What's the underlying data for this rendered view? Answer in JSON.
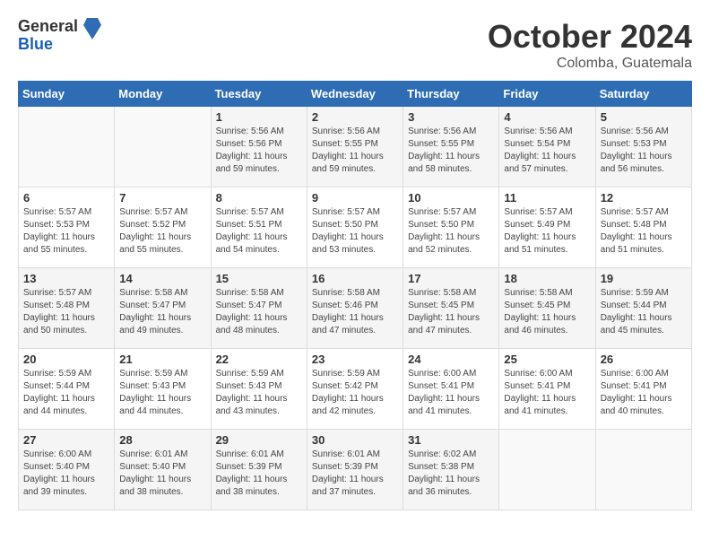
{
  "logo": {
    "general": "General",
    "blue": "Blue"
  },
  "title": "October 2024",
  "location": "Colomba, Guatemala",
  "days_of_week": [
    "Sunday",
    "Monday",
    "Tuesday",
    "Wednesday",
    "Thursday",
    "Friday",
    "Saturday"
  ],
  "weeks": [
    [
      {
        "day": "",
        "sunrise": "",
        "sunset": "",
        "daylight": ""
      },
      {
        "day": "",
        "sunrise": "",
        "sunset": "",
        "daylight": ""
      },
      {
        "day": "1",
        "sunrise": "Sunrise: 5:56 AM",
        "sunset": "Sunset: 5:56 PM",
        "daylight": "Daylight: 11 hours and 59 minutes."
      },
      {
        "day": "2",
        "sunrise": "Sunrise: 5:56 AM",
        "sunset": "Sunset: 5:55 PM",
        "daylight": "Daylight: 11 hours and 59 minutes."
      },
      {
        "day": "3",
        "sunrise": "Sunrise: 5:56 AM",
        "sunset": "Sunset: 5:55 PM",
        "daylight": "Daylight: 11 hours and 58 minutes."
      },
      {
        "day": "4",
        "sunrise": "Sunrise: 5:56 AM",
        "sunset": "Sunset: 5:54 PM",
        "daylight": "Daylight: 11 hours and 57 minutes."
      },
      {
        "day": "5",
        "sunrise": "Sunrise: 5:56 AM",
        "sunset": "Sunset: 5:53 PM",
        "daylight": "Daylight: 11 hours and 56 minutes."
      }
    ],
    [
      {
        "day": "6",
        "sunrise": "Sunrise: 5:57 AM",
        "sunset": "Sunset: 5:53 PM",
        "daylight": "Daylight: 11 hours and 55 minutes."
      },
      {
        "day": "7",
        "sunrise": "Sunrise: 5:57 AM",
        "sunset": "Sunset: 5:52 PM",
        "daylight": "Daylight: 11 hours and 55 minutes."
      },
      {
        "day": "8",
        "sunrise": "Sunrise: 5:57 AM",
        "sunset": "Sunset: 5:51 PM",
        "daylight": "Daylight: 11 hours and 54 minutes."
      },
      {
        "day": "9",
        "sunrise": "Sunrise: 5:57 AM",
        "sunset": "Sunset: 5:50 PM",
        "daylight": "Daylight: 11 hours and 53 minutes."
      },
      {
        "day": "10",
        "sunrise": "Sunrise: 5:57 AM",
        "sunset": "Sunset: 5:50 PM",
        "daylight": "Daylight: 11 hours and 52 minutes."
      },
      {
        "day": "11",
        "sunrise": "Sunrise: 5:57 AM",
        "sunset": "Sunset: 5:49 PM",
        "daylight": "Daylight: 11 hours and 51 minutes."
      },
      {
        "day": "12",
        "sunrise": "Sunrise: 5:57 AM",
        "sunset": "Sunset: 5:48 PM",
        "daylight": "Daylight: 11 hours and 51 minutes."
      }
    ],
    [
      {
        "day": "13",
        "sunrise": "Sunrise: 5:57 AM",
        "sunset": "Sunset: 5:48 PM",
        "daylight": "Daylight: 11 hours and 50 minutes."
      },
      {
        "day": "14",
        "sunrise": "Sunrise: 5:58 AM",
        "sunset": "Sunset: 5:47 PM",
        "daylight": "Daylight: 11 hours and 49 minutes."
      },
      {
        "day": "15",
        "sunrise": "Sunrise: 5:58 AM",
        "sunset": "Sunset: 5:47 PM",
        "daylight": "Daylight: 11 hours and 48 minutes."
      },
      {
        "day": "16",
        "sunrise": "Sunrise: 5:58 AM",
        "sunset": "Sunset: 5:46 PM",
        "daylight": "Daylight: 11 hours and 47 minutes."
      },
      {
        "day": "17",
        "sunrise": "Sunrise: 5:58 AM",
        "sunset": "Sunset: 5:45 PM",
        "daylight": "Daylight: 11 hours and 47 minutes."
      },
      {
        "day": "18",
        "sunrise": "Sunrise: 5:58 AM",
        "sunset": "Sunset: 5:45 PM",
        "daylight": "Daylight: 11 hours and 46 minutes."
      },
      {
        "day": "19",
        "sunrise": "Sunrise: 5:59 AM",
        "sunset": "Sunset: 5:44 PM",
        "daylight": "Daylight: 11 hours and 45 minutes."
      }
    ],
    [
      {
        "day": "20",
        "sunrise": "Sunrise: 5:59 AM",
        "sunset": "Sunset: 5:44 PM",
        "daylight": "Daylight: 11 hours and 44 minutes."
      },
      {
        "day": "21",
        "sunrise": "Sunrise: 5:59 AM",
        "sunset": "Sunset: 5:43 PM",
        "daylight": "Daylight: 11 hours and 44 minutes."
      },
      {
        "day": "22",
        "sunrise": "Sunrise: 5:59 AM",
        "sunset": "Sunset: 5:43 PM",
        "daylight": "Daylight: 11 hours and 43 minutes."
      },
      {
        "day": "23",
        "sunrise": "Sunrise: 5:59 AM",
        "sunset": "Sunset: 5:42 PM",
        "daylight": "Daylight: 11 hours and 42 minutes."
      },
      {
        "day": "24",
        "sunrise": "Sunrise: 6:00 AM",
        "sunset": "Sunset: 5:41 PM",
        "daylight": "Daylight: 11 hours and 41 minutes."
      },
      {
        "day": "25",
        "sunrise": "Sunrise: 6:00 AM",
        "sunset": "Sunset: 5:41 PM",
        "daylight": "Daylight: 11 hours and 41 minutes."
      },
      {
        "day": "26",
        "sunrise": "Sunrise: 6:00 AM",
        "sunset": "Sunset: 5:41 PM",
        "daylight": "Daylight: 11 hours and 40 minutes."
      }
    ],
    [
      {
        "day": "27",
        "sunrise": "Sunrise: 6:00 AM",
        "sunset": "Sunset: 5:40 PM",
        "daylight": "Daylight: 11 hours and 39 minutes."
      },
      {
        "day": "28",
        "sunrise": "Sunrise: 6:01 AM",
        "sunset": "Sunset: 5:40 PM",
        "daylight": "Daylight: 11 hours and 38 minutes."
      },
      {
        "day": "29",
        "sunrise": "Sunrise: 6:01 AM",
        "sunset": "Sunset: 5:39 PM",
        "daylight": "Daylight: 11 hours and 38 minutes."
      },
      {
        "day": "30",
        "sunrise": "Sunrise: 6:01 AM",
        "sunset": "Sunset: 5:39 PM",
        "daylight": "Daylight: 11 hours and 37 minutes."
      },
      {
        "day": "31",
        "sunrise": "Sunrise: 6:02 AM",
        "sunset": "Sunset: 5:38 PM",
        "daylight": "Daylight: 11 hours and 36 minutes."
      },
      {
        "day": "",
        "sunrise": "",
        "sunset": "",
        "daylight": ""
      },
      {
        "day": "",
        "sunrise": "",
        "sunset": "",
        "daylight": ""
      }
    ]
  ]
}
